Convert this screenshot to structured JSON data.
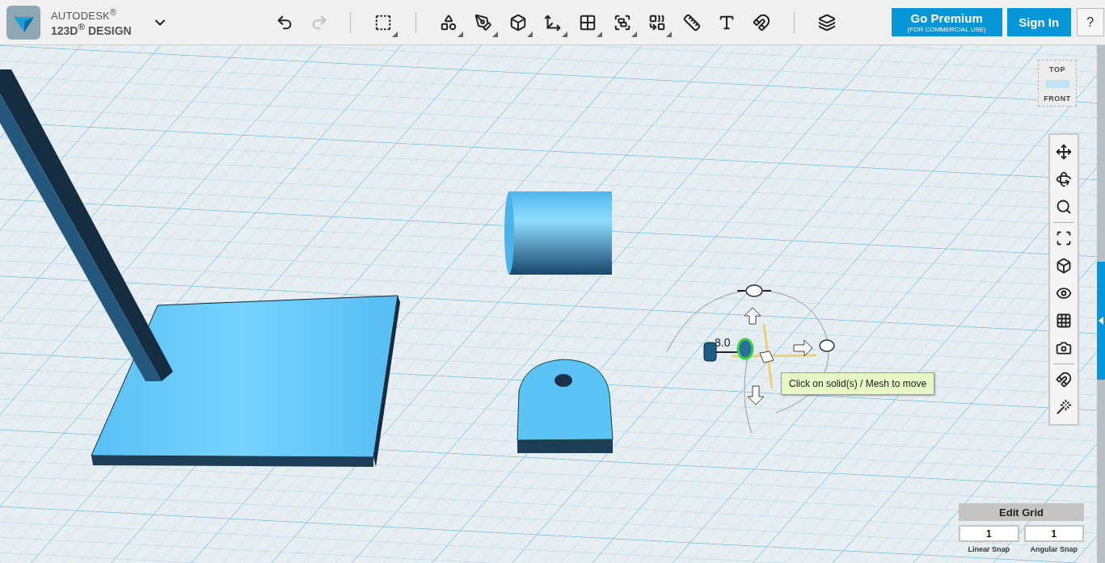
{
  "header": {
    "logo": {
      "brand": "AUTODESK$^{®}$",
      "product": "123D$^{®}$ DESIGN"
    },
    "history": [
      {
        "kind": "undo",
        "disabled": false
      },
      {
        "kind": "redo",
        "disabled": true
      }
    ],
    "transform": {
      "kind": "transform",
      "menu": true
    },
    "tools": [
      {
        "kind": "primitives",
        "menu": true
      },
      {
        "kind": "sketch",
        "menu": true
      },
      {
        "kind": "construct",
        "menu": true
      },
      {
        "kind": "modify",
        "menu": true
      },
      {
        "kind": "pattern",
        "menu": true
      },
      {
        "kind": "grouping",
        "menu": true
      },
      {
        "kind": "combine",
        "menu": true
      },
      {
        "kind": "measure",
        "menu": false
      },
      {
        "kind": "text",
        "menu": false
      },
      {
        "kind": "snap",
        "menu": false
      }
    ],
    "materials": {
      "kind": "materials",
      "menu": false
    },
    "go_premium": {
      "label": "Go Premium",
      "sublabel": "(FOR COMMERCIAL USE)"
    },
    "sign_in": "Sign In",
    "help": "?"
  },
  "view_cube": {
    "top": "TOP",
    "front": "FRONT"
  },
  "navigation": [
    {
      "kind": "pan"
    },
    {
      "kind": "orbit"
    },
    {
      "kind": "zoom"
    },
    {
      "kind": "separator"
    },
    {
      "kind": "fit"
    },
    {
      "kind": "material"
    },
    {
      "kind": "visibility"
    },
    {
      "kind": "grid-visibility"
    },
    {
      "kind": "snapshot"
    },
    {
      "kind": "separator"
    },
    {
      "kind": "snap"
    },
    {
      "kind": "sculpt"
    }
  ],
  "viewport": {
    "dimension": "8.0",
    "tooltip": "Click on solid(s) / Mesh to move"
  },
  "edit_grid": {
    "title": "Edit Grid",
    "fields": [
      {
        "value": "1",
        "label": "Linear Snap"
      },
      {
        "value": "1",
        "label": "Angular Snap"
      }
    ]
  }
}
